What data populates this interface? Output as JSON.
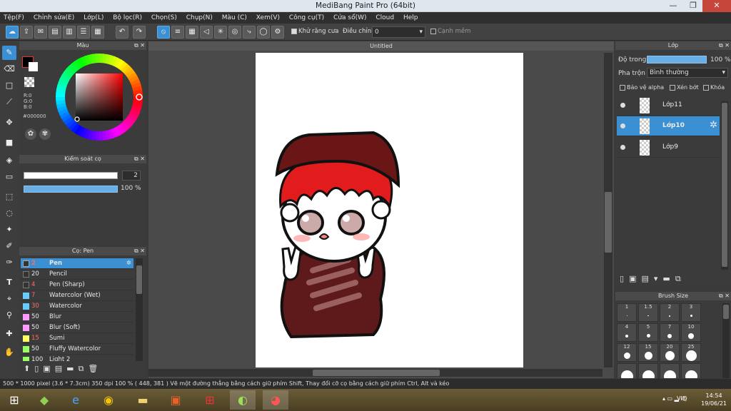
{
  "window": {
    "title": "MediBang Paint Pro (64bit)",
    "minimize": "—",
    "restore": "❐",
    "close": "✕"
  },
  "menu": [
    "Tệp(F)",
    "Chỉnh sửa(E)",
    "Lớp(L)",
    "Bộ lọc(R)",
    "Chọn(S)",
    "Chụp(N)",
    "Màu (C)",
    "Xem(V)",
    "Công cụ(T)",
    "Cửa sổ(W)",
    "Cloud",
    "Help"
  ],
  "toolbar": {
    "antialias_label": "Khử răng cưa",
    "adjust_label": "Điều chỉnh",
    "adjust_value": "0",
    "edge_label": "Cạnh mềm"
  },
  "color_panel": {
    "title": "Màu",
    "r": "R:0",
    "g": "G:0",
    "b": "B:0",
    "hex": "#000000",
    "primary": "#000000",
    "secondary": "#ffffff"
  },
  "brush_control": {
    "title": "Kiểm soát cọ",
    "size": "2",
    "opacity": "100 %"
  },
  "brush_panel": {
    "title": "Cọ: Pen",
    "brushes": [
      {
        "size": "2",
        "name": "Pen",
        "color": "#333333",
        "selected": true
      },
      {
        "size": "20",
        "name": "Pencil",
        "color": "#333333"
      },
      {
        "size": "4",
        "name": "Pen (Sharp)",
        "color": "#333333"
      },
      {
        "size": "7",
        "name": "Watercolor (Wet)",
        "color": "#66ccff"
      },
      {
        "size": "30",
        "name": "Watercolor",
        "color": "#66ccff"
      },
      {
        "size": "50",
        "name": "Blur",
        "color": "#ff99ff"
      },
      {
        "size": "50",
        "name": "Blur (Soft)",
        "color": "#ff99ff"
      },
      {
        "size": "15",
        "name": "Sumi",
        "color": "#ffff66"
      },
      {
        "size": "50",
        "name": "Fluffy Watercolor",
        "color": "#99ff66"
      },
      {
        "size": "100",
        "name": "Light 2",
        "color": "#99ff66"
      }
    ]
  },
  "document": {
    "tab": "Untitled"
  },
  "layer_panel": {
    "title": "Lớp",
    "opacity_label": "Độ trong",
    "opacity_value": "100 %",
    "blend_label": "Pha trộn",
    "blend_value": "Bình thường",
    "protect_alpha": "Bảo vệ alpha",
    "clipping": "Xén bớt",
    "lock": "Khóa",
    "layers": [
      {
        "name": "Lớp11",
        "selected": false
      },
      {
        "name": "Lớp10",
        "selected": true
      },
      {
        "name": "Lớp9",
        "selected": false
      }
    ]
  },
  "brush_size_panel": {
    "title": "Brush Size",
    "sizes": [
      "1",
      "1.5",
      "2",
      "3",
      "4",
      "5",
      "7",
      "10",
      "12",
      "15",
      "20",
      "25",
      "",
      "",
      "",
      ""
    ]
  },
  "status": {
    "text": "500 * 1000 pixel   (3.6 * 7.3cm)   350 dpi   100 %   ( 448, 381 )   Vẽ một đường thẳng bằng cách giữ phím Shift, Thay đổi cỡ cọ bằng cách giữ phím Ctrl, Alt và kéo"
  },
  "taskbar": {
    "lang": "VIE",
    "time": "14:54",
    "date": "19/06/21"
  }
}
